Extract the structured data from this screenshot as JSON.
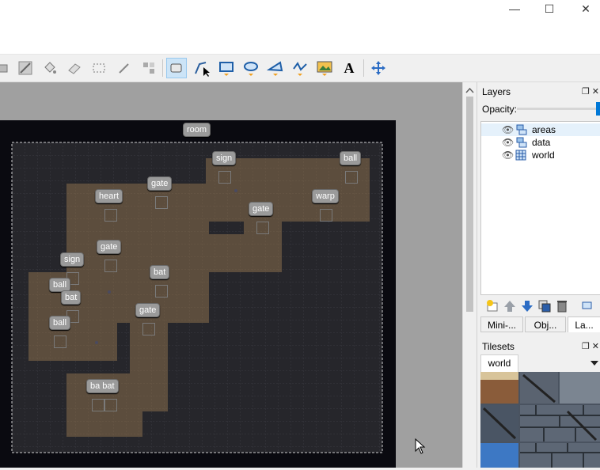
{
  "window": {
    "minimize_icon": "minimize-icon",
    "maximize_icon": "maximize-icon",
    "close_icon": "close-icon",
    "minimize_glyph": "—",
    "maximize_glyph": "☐",
    "close_glyph": "✕"
  },
  "toolbar": {
    "tools": [
      "stamp-brush-icon",
      "terrain-brush-icon",
      "bucket-fill-icon",
      "eraser-icon",
      "rectangular-select-icon",
      "magic-wand-icon",
      "select-same-tile-icon",
      "select-objects-icon",
      "edit-polygons-icon",
      "insert-rectangle-icon",
      "insert-ellipse-icon",
      "insert-polygon-icon",
      "insert-polyline-icon",
      "insert-tile-icon",
      "insert-text-icon",
      "move-icon"
    ],
    "text_tool_glyph": "A"
  },
  "map": {
    "labels": [
      {
        "id": "room",
        "text": "room"
      },
      {
        "id": "sign1",
        "text": "sign"
      },
      {
        "id": "ball1",
        "text": "ball"
      },
      {
        "id": "gate1",
        "text": "gate"
      },
      {
        "id": "heart",
        "text": "heart"
      },
      {
        "id": "warp",
        "text": "warp"
      },
      {
        "id": "gate2",
        "text": "gate"
      },
      {
        "id": "gate3",
        "text": "gate"
      },
      {
        "id": "sign2",
        "text": "sign"
      },
      {
        "id": "bat1",
        "text": "bat"
      },
      {
        "id": "ball2",
        "text": "ball"
      },
      {
        "id": "bat2",
        "text": "bat"
      },
      {
        "id": "gate4",
        "text": "gate"
      },
      {
        "id": "ball3",
        "text": "ball"
      },
      {
        "id": "babat",
        "text": "ba bat"
      }
    ]
  },
  "layers_panel": {
    "title": "Layers",
    "opacity_label": "Opacity:",
    "layers": [
      {
        "name": "areas",
        "type_icon": "object-layer-icon",
        "visible": true,
        "selected": true
      },
      {
        "name": "data",
        "type_icon": "object-layer-icon",
        "visible": true,
        "selected": false
      },
      {
        "name": "world",
        "type_icon": "tile-layer-icon",
        "visible": true,
        "selected": false
      }
    ],
    "tabs": [
      "Mini-...",
      "Obj...",
      "La..."
    ],
    "active_tab": "La..."
  },
  "tilesets_panel": {
    "title": "Tilesets",
    "current": "world"
  }
}
